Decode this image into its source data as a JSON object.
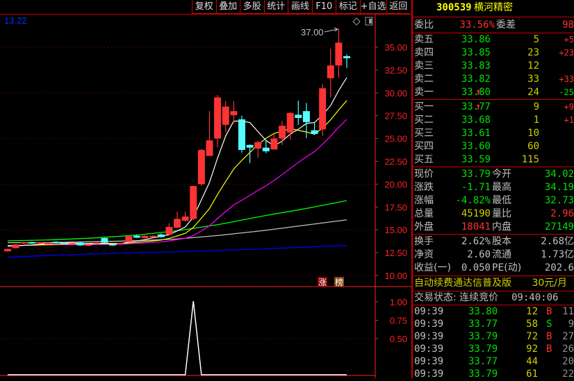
{
  "toolbar": [
    "复权",
    "叠加",
    "多股",
    "统计",
    "画线",
    "F10",
    "标记",
    "+自选",
    "返回"
  ],
  "stock": {
    "code": "300539",
    "name": "横河精密"
  },
  "chart_labels": {
    "ma_value": "13.22",
    "high_marker": "37.00",
    "badge_rise": "涨",
    "badge_rank": "榜"
  },
  "colors": {
    "up": "#ff3333",
    "down": "#55ffff",
    "ma5": "#ffffff",
    "ma10": "#ffff00",
    "ma20": "#ff00ff",
    "ma60": "#00ff00",
    "ma120": "#c0c0c0",
    "ma250": "#0000ff",
    "grid": "#8b0000",
    "axis": "#ff2020"
  },
  "chart_data": {
    "type": "candlestick",
    "y_ticks": [
      "35.00",
      "32.50",
      "30.00",
      "27.50",
      "25.00",
      "22.50",
      "20.00",
      "17.50",
      "15.00",
      "12.50",
      "10.00"
    ],
    "ylim": [
      10,
      35
    ],
    "candles": [
      [
        12.65,
        12.9,
        12.95,
        12.6
      ],
      [
        13.0,
        13.4,
        13.45,
        12.95
      ],
      [
        13.5,
        13.65,
        13.7,
        13.45
      ],
      [
        13.65,
        13.5,
        13.7,
        13.45
      ],
      [
        13.5,
        13.65,
        13.7,
        13.45
      ],
      [
        13.45,
        13.6,
        13.65,
        13.4
      ],
      [
        13.7,
        13.55,
        13.75,
        13.5
      ],
      [
        13.55,
        13.5,
        13.6,
        13.45
      ],
      [
        13.5,
        13.55,
        13.6,
        13.45
      ],
      [
        13.6,
        13.3,
        13.65,
        13.25
      ],
      [
        13.25,
        13.4,
        13.45,
        13.2
      ],
      [
        13.5,
        13.6,
        13.65,
        13.45
      ],
      [
        14.1,
        13.6,
        14.15,
        13.55
      ],
      [
        13.4,
        13.3,
        13.45,
        13.25
      ],
      [
        13.5,
        13.55,
        13.6,
        13.45
      ],
      [
        13.7,
        14.3,
        14.4,
        13.65
      ],
      [
        14.35,
        14.15,
        14.5,
        14.1
      ],
      [
        14.1,
        14.35,
        14.4,
        14.05
      ],
      [
        14.2,
        14.35,
        14.4,
        14.15
      ],
      [
        14.5,
        14.2,
        14.6,
        14.15
      ],
      [
        14.48,
        15.32,
        15.7,
        14.45
      ],
      [
        15.24,
        16.2,
        17.0,
        15.2
      ],
      [
        16.0,
        16.46,
        17.0,
        15.9
      ],
      [
        16.2,
        19.8,
        19.8,
        16.05
      ],
      [
        20.0,
        23.75,
        23.9,
        19.8
      ],
      [
        23.1,
        24.8,
        28.0,
        23.1
      ],
      [
        25.0,
        29.5,
        29.75,
        24.05
      ],
      [
        26.5,
        28.5,
        29.1,
        25.7
      ],
      [
        27.55,
        28.0,
        29.1,
        26.7
      ],
      [
        27.1,
        23.75,
        27.5,
        23.45
      ],
      [
        24.3,
        24.0,
        24.35,
        22.3
      ],
      [
        23.9,
        24.6,
        24.75,
        22.9
      ],
      [
        24.0,
        23.6,
        24.8,
        23.4
      ],
      [
        23.8,
        25.0,
        25.5,
        24.2
      ],
      [
        25.0,
        26.4,
        26.9,
        24.3
      ],
      [
        25.65,
        27.8,
        27.9,
        24.9
      ],
      [
        27.6,
        27.25,
        29.15,
        26.5
      ],
      [
        28.0,
        26.8,
        28.9,
        25.05
      ],
      [
        25.9,
        25.5,
        26.7,
        25.4
      ],
      [
        26.0,
        30.5,
        31.0,
        25.3
      ],
      [
        31.6,
        33.0,
        34.85,
        29.5
      ],
      [
        33.0,
        35.5,
        37.0,
        31.65
      ],
      [
        34.02,
        33.79,
        34.19,
        32.73
      ]
    ],
    "long_ma": {
      "ma60": [
        13.8,
        13.9,
        14.1,
        14.4,
        14.9,
        15.6,
        16.5,
        17.3,
        18.2
      ],
      "ma120": [
        13.6,
        13.6,
        13.7,
        13.8,
        14.0,
        14.4,
        14.9,
        15.5,
        16.1
      ],
      "ma250": [
        12.0,
        12.2,
        12.35,
        12.5,
        12.6,
        12.75,
        12.9,
        13.1,
        13.3
      ]
    },
    "indicator": {
      "y_ticks": [
        "1.00",
        "0.75",
        "0.50"
      ],
      "ylim": [
        0,
        1
      ],
      "values": [
        0,
        0,
        0,
        0,
        0,
        0,
        0,
        0,
        0,
        0,
        0,
        0,
        0,
        0,
        0,
        0,
        0,
        0,
        0,
        0,
        0,
        0,
        0,
        1,
        0,
        0,
        0,
        0,
        0,
        0,
        0,
        0,
        0,
        0,
        0,
        0,
        0,
        0,
        0,
        0,
        0,
        0,
        0
      ]
    }
  },
  "quote": {
    "wb_label": "委比",
    "wb": "33.56%",
    "wc_label": "委差",
    "wc": "98",
    "asks": [
      {
        "label": "卖五",
        "price": "33.86",
        "vol": "5",
        "chg": "+5"
      },
      {
        "label": "卖四",
        "price": "33.85",
        "vol": "23",
        "chg": "+23"
      },
      {
        "label": "卖三",
        "price": "33.83",
        "vol": "12",
        "chg": ""
      },
      {
        "label": "卖二",
        "price": "33.82",
        "vol": "33",
        "chg": "+33"
      },
      {
        "label": "卖一",
        "price": "33.80",
        "vol": "24",
        "chg": "-25",
        "arrow": "↑"
      }
    ],
    "bids": [
      {
        "label": "买一",
        "price": "33.77",
        "vol": "9",
        "chg": "+9",
        "arrow": "↑"
      },
      {
        "label": "买二",
        "price": "33.68",
        "vol": "1",
        "chg": "+1"
      },
      {
        "label": "买三",
        "price": "33.61",
        "vol": "10",
        "chg": ""
      },
      {
        "label": "买四",
        "price": "33.60",
        "vol": "60",
        "chg": ""
      },
      {
        "label": "买五",
        "price": "33.59",
        "vol": "115",
        "chg": ""
      }
    ],
    "stats": [
      {
        "l1": "现价",
        "v1": "33.79",
        "c1": "g",
        "l2": "今开",
        "v2": "34.02",
        "c2": "g"
      },
      {
        "l1": "涨跌",
        "v1": "-1.71",
        "c1": "g",
        "l2": "最高",
        "v2": "34.19",
        "c2": "g"
      },
      {
        "l1": "涨幅",
        "v1": "-4.82%",
        "c1": "g",
        "l2": "最低",
        "v2": "32.73",
        "c2": "g"
      },
      {
        "l1": "总量",
        "v1": "45190",
        "c1": "y",
        "l2": "量比",
        "v2": "2.96",
        "c2": "r"
      },
      {
        "l1": "外盘",
        "v1": "18041",
        "c1": "r",
        "l2": "内盘",
        "v2": "27149",
        "c2": "g"
      }
    ],
    "fin": [
      {
        "l1": "换手",
        "v1": "2.62%",
        "l2": "股本",
        "v2": "2.68亿"
      },
      {
        "l1": "净资",
        "v1": "2.60",
        "l2": "流通",
        "v2": "1.73亿"
      },
      {
        "l1": "收益(一)",
        "v1": "0.050",
        "l2": "PE(动)",
        "v2": "202.6"
      }
    ],
    "promo": "自动续费通达信普及版",
    "promo_price": "30元/月",
    "status": "交易状态: 连续竞价",
    "status_time": "09:40:06",
    "ticks": [
      {
        "t": "09:39",
        "p": "33.80",
        "v": "12",
        "bs": "B",
        "n": "11"
      },
      {
        "t": "09:39",
        "p": "33.77",
        "v": "58",
        "bs": "S",
        "n": "9"
      },
      {
        "t": "09:39",
        "p": "33.79",
        "v": "72",
        "bs": "B",
        "n": "27"
      },
      {
        "t": "09:39",
        "p": "33.79",
        "v": "92",
        "bs": "B",
        "n": "26"
      },
      {
        "t": "09:39",
        "p": "33.77",
        "v": "44",
        "bs": "",
        "n": "20"
      },
      {
        "t": "09:39",
        "p": "33.79",
        "v": "61",
        "bs": "",
        "n": "22"
      }
    ]
  }
}
